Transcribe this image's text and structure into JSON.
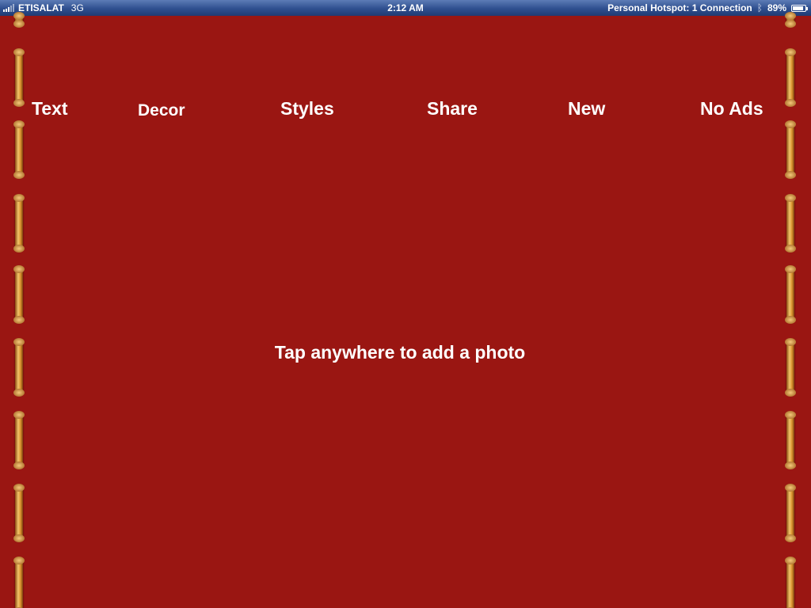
{
  "status_bar": {
    "carrier": "ETISALAT",
    "network": "3G",
    "time": "2:12 AM",
    "hotspot": "Personal Hotspot: 1 Connection",
    "battery": "89%",
    "battery_level": 0.89,
    "icons": [
      "signal-icon",
      "bluetooth-icon",
      "battery-icon"
    ]
  },
  "toolbar": {
    "text": "Text",
    "decor": "Decor",
    "styles": "Styles",
    "share": "Share",
    "new": "New",
    "no_ads": "No Ads"
  },
  "canvas": {
    "prompt": "Tap anywhere to add a photo",
    "background_color": "#9a1612",
    "binding_color": "#d9922e"
  }
}
